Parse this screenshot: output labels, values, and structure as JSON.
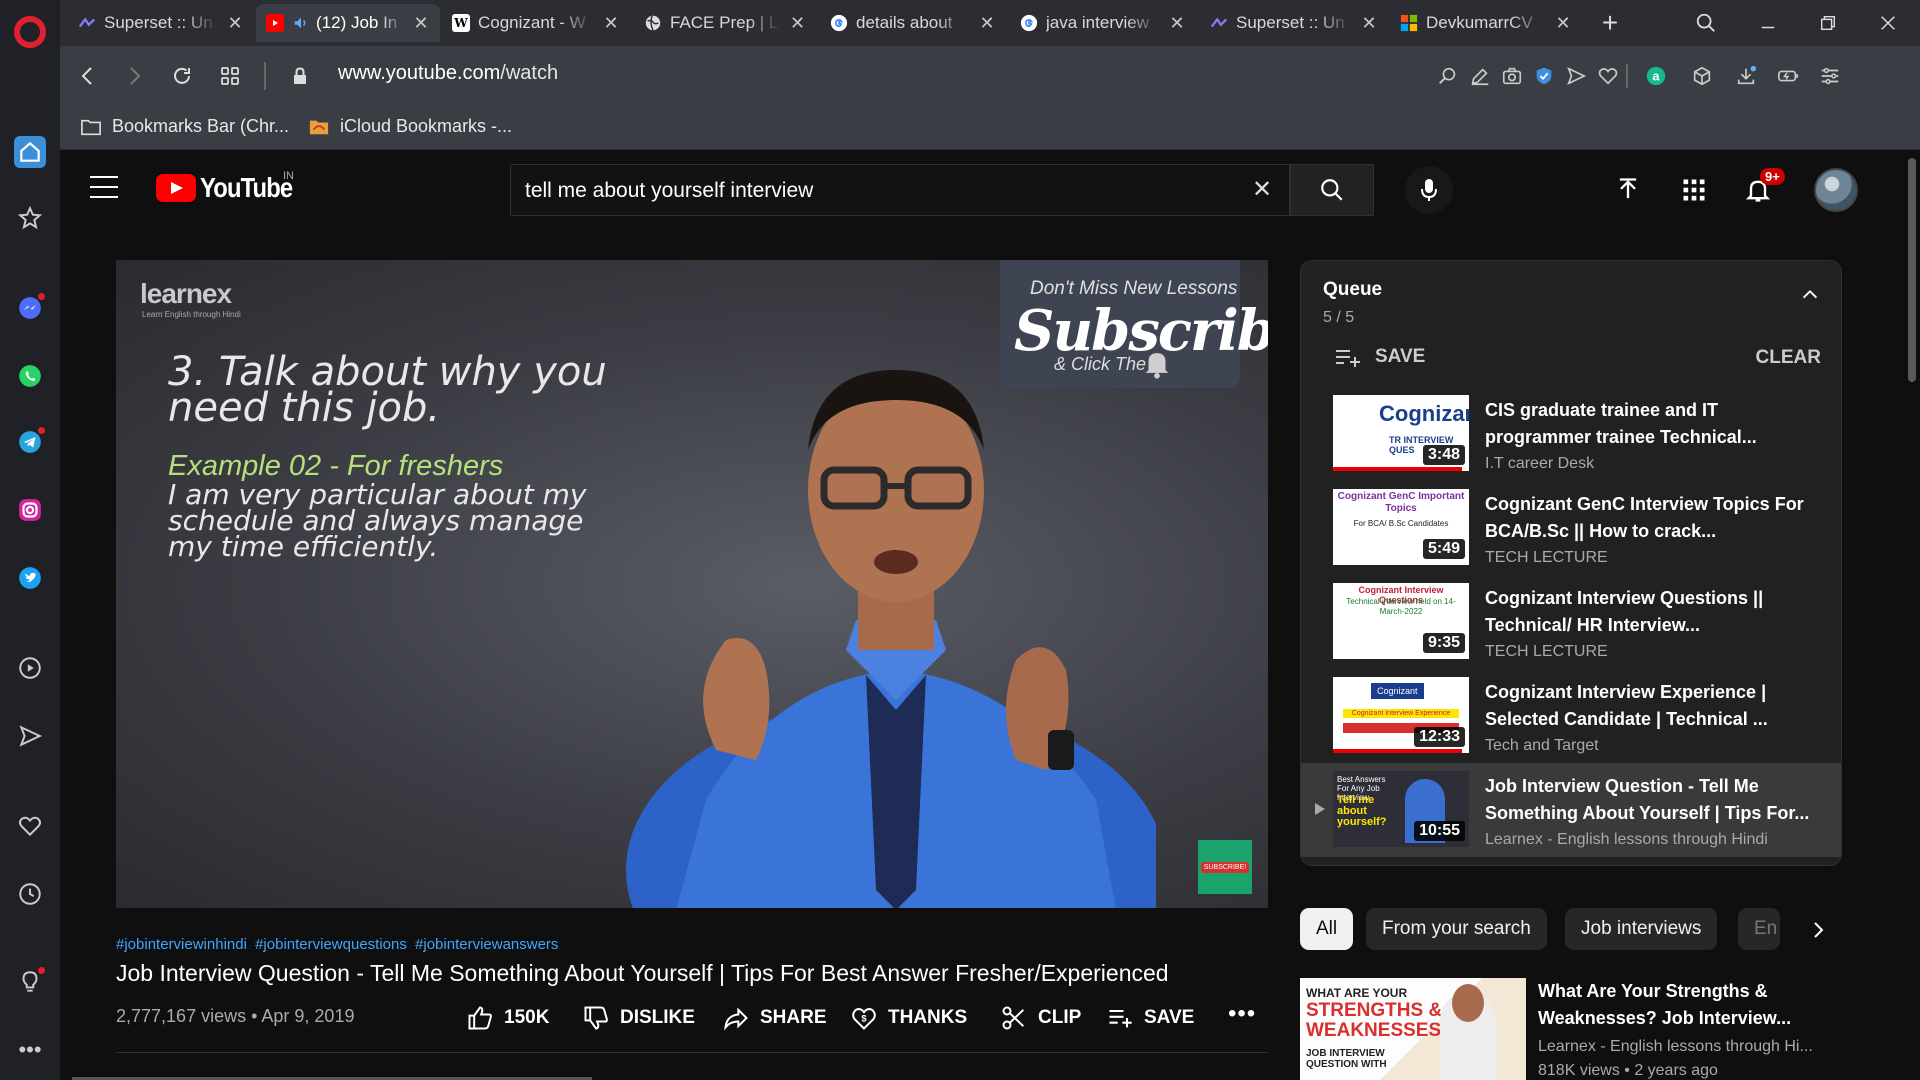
{
  "browser": {
    "tabs": [
      {
        "label": "Superset :: Un",
        "favicon": "superset-icon",
        "active": false
      },
      {
        "label": "(12) Job In",
        "favicon": "youtube-icon",
        "active": true,
        "audio": true
      },
      {
        "label": "Cognizant - W",
        "favicon": "wikipedia-icon",
        "active": false
      },
      {
        "label": "FACE Prep | La",
        "favicon": "globe-icon",
        "active": false
      },
      {
        "label": "details about",
        "favicon": "google-icon",
        "active": false
      },
      {
        "label": "java interview",
        "favicon": "google-icon",
        "active": false
      },
      {
        "label": "Superset :: Un",
        "favicon": "superset-icon",
        "active": false
      },
      {
        "label": "DevkumarrCV",
        "favicon": "microsoft-icon",
        "active": false
      }
    ],
    "address": {
      "host": "www.youtube.com",
      "path": "/watch"
    },
    "bookmarks": [
      {
        "label": "Bookmarks Bar (Chr...",
        "icon": "folder-icon"
      },
      {
        "label": "iCloud Bookmarks -...",
        "icon": "folder-icon"
      }
    ],
    "extension_badge_letter": "a"
  },
  "youtube": {
    "logo_text": "YouTube",
    "country_code": "IN",
    "search": {
      "value": "tell me about yourself interview",
      "clear": "✕"
    },
    "notifications_badge": "9+",
    "player": {
      "brand": "learnex",
      "brand_sub": "Learn English through Hindi",
      "heading_line1": "3. Talk about why you",
      "heading_line2": "need this job.",
      "example": "Example 02 - For freshers",
      "body_line1": "I am very particular about my",
      "body_line2": "schedule and always manage",
      "body_line3": "my time efficiently.",
      "subscribe_top": "Don't Miss New Lessons",
      "subscribe_big": "Subscribe",
      "subscribe_click": "& Click The",
      "mini_subscribe": "SUBSCRIBE!"
    },
    "video": {
      "hashtags": [
        "#jobinterviewinhindi",
        "#jobinterviewquestions",
        "#jobinterviewanswers"
      ],
      "title": "Job Interview Question - Tell Me Something About Yourself | Tips For Best Answer Fresher/Experienced",
      "views_date": "2,777,167 views • Apr 9, 2019",
      "actions": {
        "like": "150K",
        "dislike": "DISLIKE",
        "share": "SHARE",
        "thanks": "THANKS",
        "clip": "CLIP",
        "save": "SAVE",
        "more": "•••"
      }
    },
    "queue": {
      "title": "Queue",
      "count": "5 / 5",
      "save": "SAVE",
      "clear": "CLEAR",
      "items": [
        {
          "title": "CIS graduate trainee and IT programmer trainee Technical...",
          "channel": "I.T career Desk",
          "duration": "3:48",
          "thumb_text": "Cognizant",
          "thumb_sub": "TR INTERVIEW QUES",
          "watched": 0.95
        },
        {
          "title": "Cognizant GenC Interview Topics For BCA/B.Sc || How to crack...",
          "channel": "TECH LECTURE",
          "duration": "5:49",
          "thumb_text": "Cognizant GenC Important Topics",
          "thumb_sub": "For BCA/ B.Sc Candidates",
          "watched": 0
        },
        {
          "title": "Cognizant Interview Questions || Technical/ HR Interview...",
          "channel": "TECH LECTURE",
          "duration": "9:35",
          "thumb_text": "Cognizant Interview Questions",
          "thumb_sub": "Technical interview held on 14-March-2022",
          "watched": 0
        },
        {
          "title": "Cognizant Interview Experience | Selected Candidate | Technical ...",
          "channel": "Tech and Target",
          "duration": "12:33",
          "thumb_text": "Cognizant",
          "thumb_sub": "Cognizant Interview Experience",
          "watched": 0.95
        },
        {
          "title": "Job Interview Question - Tell Me Something About Yourself | Tips For...",
          "channel": "Learnex - English lessons through Hindi",
          "duration": "10:55",
          "thumb_text": "Tell me about yourself?",
          "thumb_sub": "Best Answers For Any Job Interview",
          "watched": 0,
          "current": true
        }
      ]
    },
    "chips": [
      {
        "label": "All",
        "active": true
      },
      {
        "label": "From your search",
        "active": false
      },
      {
        "label": "Job interviews",
        "active": false
      },
      {
        "label": "En",
        "active": false
      }
    ],
    "recommended": [
      {
        "title": "What Are Your Strengths & Weaknesses? Job Interview...",
        "channel": "Learnex - English lessons through Hi...",
        "meta": "818K views • 2 years ago",
        "thumb_line1": "WHAT ARE YOUR",
        "thumb_line2": "STRENGTHS &",
        "thumb_line3": "WEAKNESSES",
        "thumb_line4": "JOB INTERVIEW QUESTION WITH"
      }
    ]
  }
}
